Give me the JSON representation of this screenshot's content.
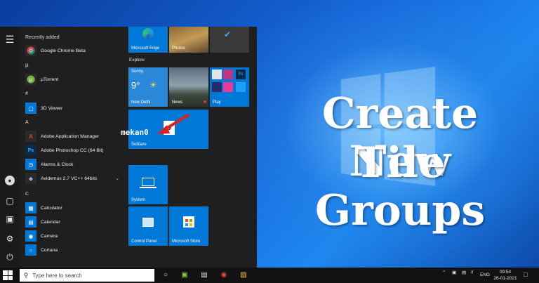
{
  "headline": {
    "line1": "Create New",
    "line2": "Tile Groups"
  },
  "start_menu": {
    "sections": {
      "recently_added": "Recently added",
      "hash": "#",
      "a": "A",
      "c": "C"
    },
    "apps": [
      {
        "label": "Google Chrome Beta",
        "icon": "chrome-icon",
        "color": "#2a2a2a"
      },
      {
        "label": "µTorrent",
        "icon": "utorrent-icon",
        "color": "#2a2a2a"
      },
      {
        "label": "3D Viewer",
        "icon": "cube-icon",
        "color": "#0078d7"
      },
      {
        "label": "Adobe Application Manager",
        "icon": "adobe-icon",
        "color": "#2a2a2a"
      },
      {
        "label": "Adobe Photoshop CC (64 Bit)",
        "icon": "photoshop-icon",
        "color": "#0b2a4a"
      },
      {
        "label": "Alarms & Clock",
        "icon": "clock-icon",
        "color": "#0078d7"
      },
      {
        "label": "Avidemux 2.7 VC++ 64bits",
        "icon": "avidemux-icon",
        "color": "#2a2a2a"
      },
      {
        "label": "Calculator",
        "icon": "calculator-icon",
        "color": "#0078d7"
      },
      {
        "label": "Calendar",
        "icon": "calendar-icon",
        "color": "#0078d7"
      },
      {
        "label": "Camera",
        "icon": "camera-icon",
        "color": "#0078d7"
      },
      {
        "label": "Cortana",
        "icon": "cortana-icon",
        "color": "#0078d7"
      }
    ],
    "tiles": {
      "edge": "Microsoft Edge",
      "photos": "Photos",
      "explore_label": "Explore",
      "weather_city_label": "Sunny",
      "weather_temp": "9°",
      "weather_city": "New Delhi",
      "news": "News",
      "play": "Play",
      "solitaire": "Solitaire",
      "system": "System",
      "control_panel": "Control Panel",
      "store": "Microsoft Store"
    },
    "new_group_name": "mekan0"
  },
  "taskbar": {
    "search_placeholder": "Type here to search",
    "language": "ENG",
    "time": "09:54",
    "date": "26-01-2021"
  },
  "colors": {
    "tile_blue": "#0078d7",
    "menu_bg": "#1f1f1f",
    "arrow_red": "#e02020"
  }
}
